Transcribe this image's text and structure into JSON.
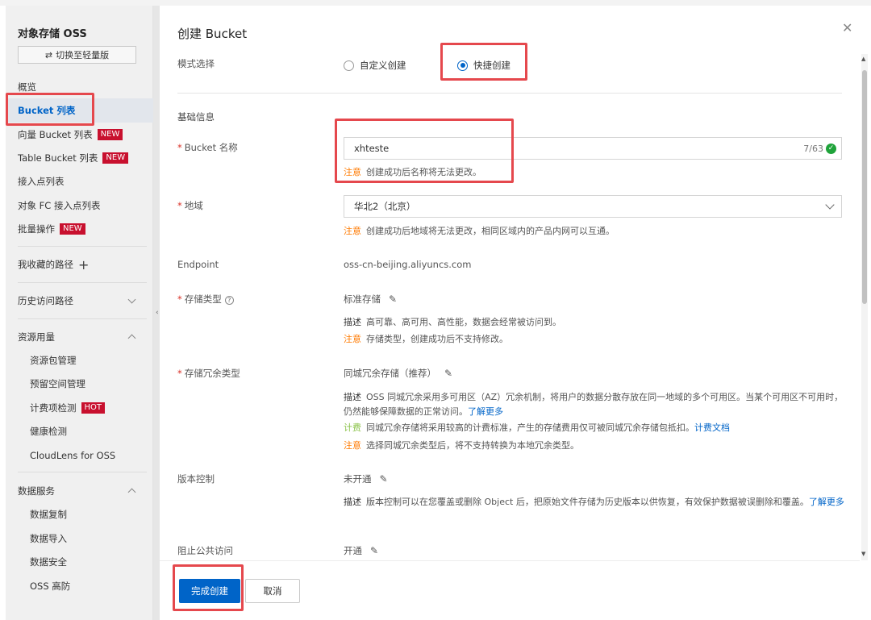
{
  "sidebar": {
    "title": "对象存储 OSS",
    "switch_label": "切换至轻量版",
    "items": {
      "overview": "概览",
      "bucket_list": "Bucket 列表",
      "vector_bucket": "向量 Bucket 列表",
      "table_bucket": "Table Bucket 列表",
      "access_points": "接入点列表",
      "fc_access_points": "对象 FC 接入点列表",
      "batch_ops": "批量操作",
      "fav_paths": "我收藏的路径",
      "history_paths": "历史访问路径",
      "resource_usage": "资源用量",
      "resource_pkg": "资源包管理",
      "reserved_space": "预留空间管理",
      "billing_check": "计费项检测",
      "health_check": "健康检测",
      "cloudlens": "CloudLens for OSS",
      "data_services": "数据服务",
      "data_replication": "数据复制",
      "data_import": "数据导入",
      "data_security": "数据安全",
      "oss_defense": "OSS 高防"
    },
    "tags": {
      "new": "NEW",
      "hot": "HOT"
    }
  },
  "panel": {
    "title": "创建 Bucket",
    "mode": {
      "label": "模式选择",
      "options": [
        "自定义创建",
        "快捷创建"
      ],
      "selected": "快捷创建"
    },
    "basic_info": "基础信息",
    "bucket_name": {
      "label": "Bucket 名称",
      "value": "xhteste",
      "counter": "7/63",
      "note_kw": "注意",
      "note": "创建成功后名称将无法更改。"
    },
    "region": {
      "label": "地域",
      "value": "华北2（北京）",
      "note_kw": "注意",
      "note": "创建成功后地域将无法更改，相同区域内的产品内网可以互通。"
    },
    "endpoint": {
      "label": "Endpoint",
      "value": "oss-cn-beijing.aliyuncs.com"
    },
    "storage_class": {
      "label": "存储类型",
      "value": "标准存储",
      "desc_kw": "描述",
      "desc": "高可靠、高可用、高性能，数据会经常被访问到。",
      "note_kw": "注意",
      "note": "存储类型，创建成功后不支持修改。"
    },
    "redundancy": {
      "label": "存储冗余类型",
      "value": "同城冗余存储（推荐）",
      "desc_kw": "描述",
      "desc": "OSS 同城冗余采用多可用区（AZ）冗余机制，将用户的数据分散存放在同一地域的多个可用区。当某个可用区不可用时，仍然能够保障数据的正常访问。",
      "desc_link": "了解更多",
      "bill_kw": "计费",
      "bill": "同城冗余存储将采用较高的计费标准，产生的存储费用仅可被同城冗余存储包抵扣。",
      "bill_link": "计费文档",
      "note_kw": "注意",
      "note": "选择同城冗余类型后，将不支持转换为本地冗余类型。"
    },
    "versioning": {
      "label": "版本控制",
      "value": "未开通",
      "desc_kw": "描述",
      "desc": "版本控制可以在您覆盖或删除 Object 后，把原始文件存储为历史版本以供恢复，有效保护数据被误删除和覆盖。",
      "desc_link": "了解更多"
    },
    "block_public": {
      "label": "阻止公共访问",
      "value": "开通"
    },
    "footer": {
      "confirm": "完成创建",
      "cancel": "取消"
    }
  },
  "colors": {
    "primary": "#0064c8",
    "highlight": "#e5484d",
    "warn": "#ff7a00",
    "tag": "#c8102e"
  }
}
